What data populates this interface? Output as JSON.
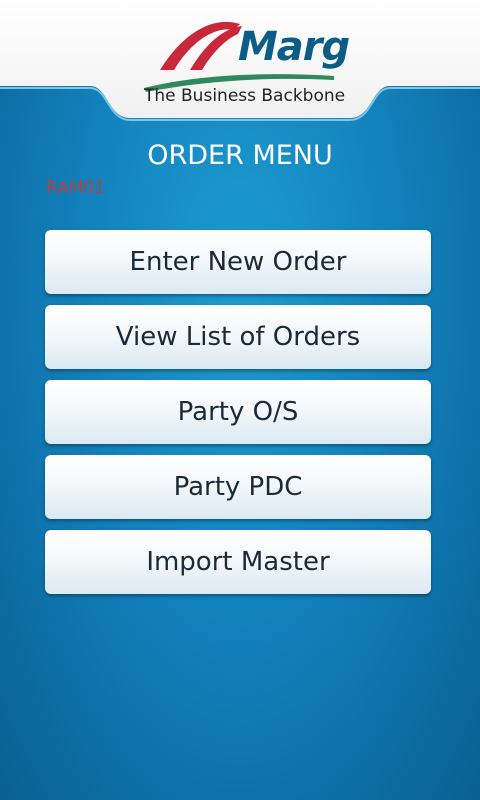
{
  "header": {
    "logo_text": "Marg",
    "tagline": "The Business Backbone"
  },
  "page": {
    "title": "ORDER MENU",
    "user_code": "RAM01"
  },
  "menu": {
    "items": [
      {
        "label": "Enter New Order"
      },
      {
        "label": "View List of Orders"
      },
      {
        "label": "Party O/S"
      },
      {
        "label": "Party PDC"
      },
      {
        "label": "Import Master"
      }
    ]
  },
  "colors": {
    "background": "#1282bd",
    "user_code": "#b84040",
    "logo_red": "#c8283a",
    "logo_blue": "#0b5d86",
    "logo_green": "#2f8a5a"
  }
}
